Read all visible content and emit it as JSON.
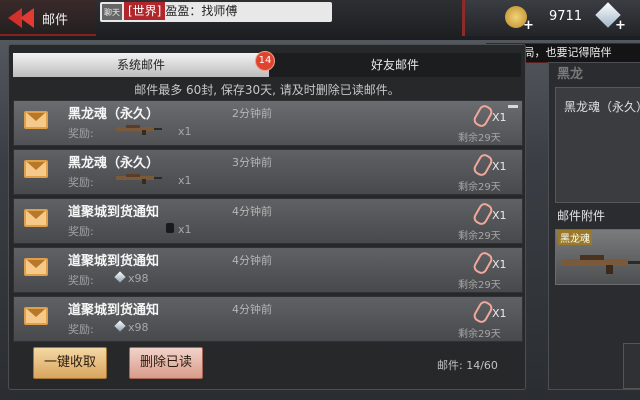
{
  "header": {
    "back_title": "邮件",
    "chat_avatar": "聊天",
    "chat_channel": "[世界]",
    "chat_user": "盈盈",
    "chat_text": "：找师傅",
    "coins": "9711"
  },
  "notice": "队开局，也要记得陪伴",
  "tabs": {
    "system": "系统邮件",
    "friend": "好友邮件",
    "badge": "14"
  },
  "info": "邮件最多 60封, 保存30天, 请及时删除已读邮件。",
  "mails": [
    {
      "title": "黑龙魂（永久）",
      "reward_label": "奖励:",
      "reward_qty": "x1",
      "ago": "2分钟前",
      "attach_qty": "X1",
      "remaining": "剩余29天",
      "reward_icon": "rifle-icon"
    },
    {
      "title": "黑龙魂（永久）",
      "reward_label": "奖励:",
      "reward_qty": "x1",
      "ago": "3分钟前",
      "attach_qty": "X1",
      "remaining": "剩余29天",
      "reward_icon": "rifle-icon"
    },
    {
      "title": "道聚城到货通知",
      "reward_label": "奖励:",
      "reward_qty": "x1",
      "ago": "4分钟前",
      "attach_qty": "X1",
      "remaining": "剩余29天",
      "reward_icon": "bag-icon"
    },
    {
      "title": "道聚城到货通知",
      "reward_label": "奖励:",
      "reward_qty": "x98",
      "ago": "4分钟前",
      "attach_qty": "X1",
      "remaining": "剩余29天",
      "reward_icon": "diamond-icon"
    },
    {
      "title": "道聚城到货通知",
      "reward_label": "奖励:",
      "reward_qty": "x98",
      "ago": "4分钟前",
      "attach_qty": "X1",
      "remaining": "剩余29天",
      "reward_icon": "diamond-icon"
    }
  ],
  "buttons": {
    "collect_all": "一键收取",
    "delete_read": "删除已读"
  },
  "mail_count": "邮件: 14/60",
  "detail": {
    "header": "黑龙",
    "title": "黑龙魂（永久）",
    "attach_label": "邮件附件",
    "item_name": "黑龙魂"
  }
}
